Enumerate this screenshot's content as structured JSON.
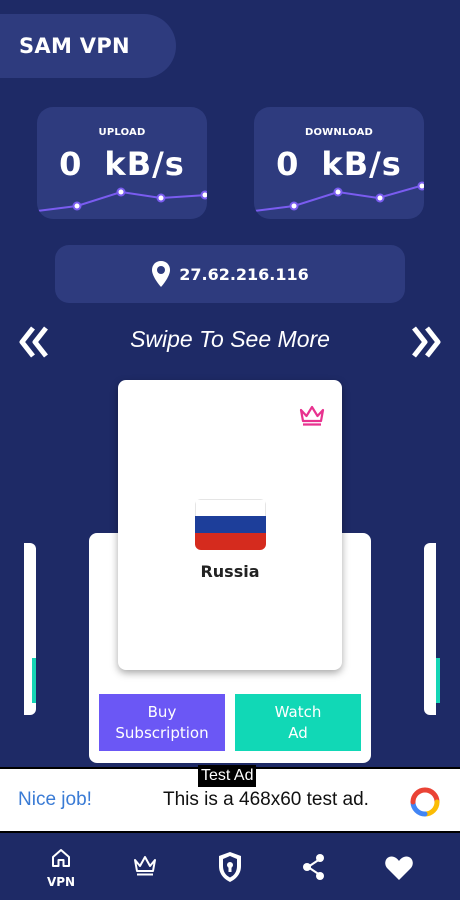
{
  "app": {
    "title": "SAM VPN"
  },
  "stats": {
    "upload": {
      "label": "UPLOAD",
      "value": "0",
      "unit": "kB/s"
    },
    "download": {
      "label": "DOWNLOAD",
      "value": "0",
      "unit": "kB/s"
    }
  },
  "ip": {
    "address": "27.62.216.116",
    "icon": "location-pin-icon"
  },
  "swipe": {
    "text": "Swipe To See More"
  },
  "server_card": {
    "country": "Russia",
    "badge_icon": "crown-icon",
    "badge_color": "#e8328f",
    "flag_colors": [
      "#ffffff",
      "#1d3e9a",
      "#d52b1e"
    ]
  },
  "actions": {
    "buy_line1": "Buy",
    "buy_line2": "Subscription",
    "watch_line1": "Watch",
    "watch_line2": "Ad",
    "buy_color": "#6b57f5",
    "watch_color": "#11d8b6"
  },
  "ad": {
    "tag": "Test Ad",
    "headline": "Nice job!",
    "body": "This is a 468x60 test ad."
  },
  "nav": {
    "items": [
      {
        "icon": "home-icon",
        "label": "VPN"
      },
      {
        "icon": "crown-icon",
        "label": ""
      },
      {
        "icon": "shield-lock-icon",
        "label": ""
      },
      {
        "icon": "share-icon",
        "label": ""
      },
      {
        "icon": "heart-icon",
        "label": ""
      }
    ]
  },
  "colors": {
    "background": "#1e2a66",
    "card": "#2e3b7e",
    "graph_line": "#7a5cf0",
    "accent": "#11d8b6"
  }
}
